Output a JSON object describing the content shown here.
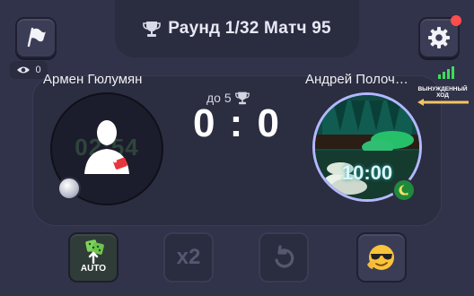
{
  "header": {
    "round_text": "Раунд 1/32 Матч 95"
  },
  "spectators": {
    "count": "0"
  },
  "players": {
    "left": {
      "name": "Армен Гюлумян",
      "timer_ghost": "02:54"
    },
    "right": {
      "name": "Андрей Полоч…",
      "timer": "10:00"
    }
  },
  "status": {
    "forced_move_label": "ВЫНУЖДЕННЫЙ ХОД"
  },
  "match": {
    "target": "до 5",
    "score": "0 : 0"
  },
  "controls": {
    "auto_label": "AUTO",
    "x2_label": "x2"
  },
  "colors": {
    "background": "#31334a",
    "accent_red": "#ff4d4d",
    "signal_green": "#3ddc5a"
  },
  "icons": [
    "flag-icon",
    "trophy-icon",
    "gear-icon",
    "eye-icon",
    "signal-icon",
    "arrow-left-icon",
    "user-icon",
    "dice-icon",
    "x2-icon",
    "undo-icon",
    "emoji-icon",
    "crescent-icon",
    "pearl-icon"
  ]
}
